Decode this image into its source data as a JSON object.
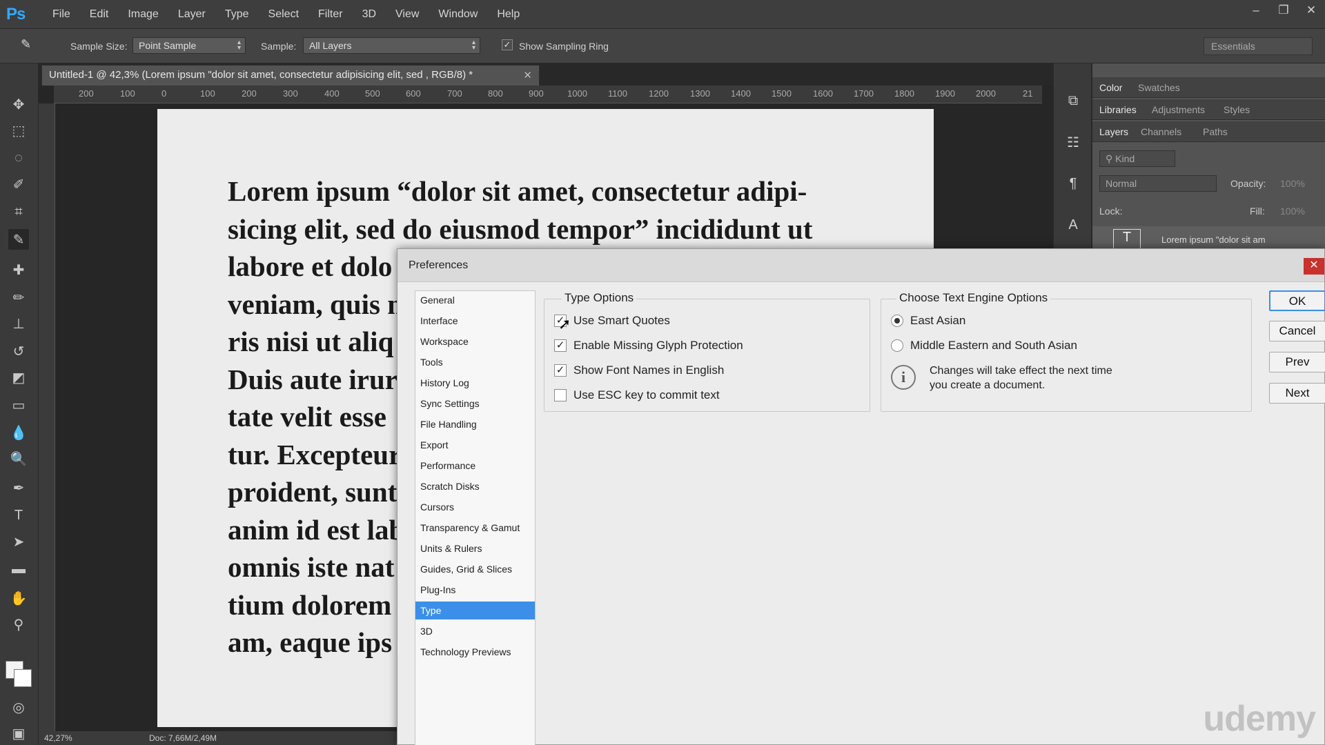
{
  "app": {
    "logo": "Ps",
    "menus": [
      "File",
      "Edit",
      "Image",
      "Layer",
      "Type",
      "Select",
      "Filter",
      "3D",
      "View",
      "Window",
      "Help"
    ],
    "window_controls": [
      "–",
      "❐",
      "✕"
    ]
  },
  "options_bar": {
    "sample_size_label": "Sample Size:",
    "sample_size_value": "Point Sample",
    "sample_label": "Sample:",
    "sample_value": "All Layers",
    "show_sampling_ring_label": "Show Sampling Ring",
    "show_sampling_ring_checked": true,
    "workspace": "Essentials"
  },
  "document": {
    "tab_title": "Untitled-1 @ 42,3% (Lorem ipsum \"dolor sit amet, consectetur adipisicing elit, sed , RGB/8) *",
    "ruler_labels": [
      "200",
      "100",
      "0",
      "100",
      "200",
      "300",
      "400",
      "500",
      "600",
      "700",
      "800",
      "900",
      "1000",
      "1100",
      "1200",
      "1300",
      "1400",
      "1500",
      "1600",
      "1700",
      "1800",
      "1900",
      "2000",
      "21"
    ],
    "text_lines": [
      "Lorem ipsum “dolor sit amet, consectetur adipi-",
      "sicing elit, sed do eiusmod tempor” incididunt ut",
      "labore et dolo",
      "veniam, quis n",
      "ris nisi ut aliq",
      "Duis aute irur",
      "tate velit esse",
      "tur. Excepteur",
      "proident, sunt",
      "anim id est lab",
      "omnis iste nat",
      "tium dolorem",
      "am, eaque ips"
    ],
    "status_zoom": "42,27%",
    "status_doc": "Doc: 7,66M/2,49M"
  },
  "panels": {
    "row1": [
      "Color",
      "Swatches"
    ],
    "row2": [
      "Libraries",
      "Adjustments",
      "Styles"
    ],
    "row3": [
      "Layers",
      "Channels",
      "Paths"
    ],
    "kind_label": "Kind",
    "blend_mode": "Normal",
    "opacity_label": "Opacity:",
    "opacity_value": "100%",
    "lock_label": "Lock:",
    "fill_label": "Fill:",
    "fill_value": "100%",
    "layer_name": "Lorem ipsum \"dolor sit am"
  },
  "preferences": {
    "title": "Preferences",
    "nav_items": [
      "General",
      "Interface",
      "Workspace",
      "Tools",
      "History Log",
      "Sync Settings",
      "File Handling",
      "Export",
      "Performance",
      "Scratch Disks",
      "Cursors",
      "Transparency & Gamut",
      "Units & Rulers",
      "Guides, Grid & Slices",
      "Plug-Ins",
      "Type",
      "3D",
      "Technology Previews"
    ],
    "selected_nav": "Type",
    "type_options": {
      "title": "Type Options",
      "items": [
        {
          "label": "Use Smart Quotes",
          "checked": true
        },
        {
          "label": "Enable Missing Glyph Protection",
          "checked": true
        },
        {
          "label": "Show Font Names in English",
          "checked": true
        },
        {
          "label": "Use ESC key to commit text",
          "checked": false
        }
      ]
    },
    "text_engine": {
      "title": "Choose Text Engine Options",
      "options": [
        {
          "label": "East Asian",
          "selected": true
        },
        {
          "label": "Middle Eastern and South Asian",
          "selected": false
        }
      ],
      "info_line1": "Changes will take effect the next time",
      "info_line2": "you create a document."
    },
    "buttons": {
      "ok": "OK",
      "cancel": "Cancel",
      "prev": "Prev",
      "next": "Next"
    }
  },
  "watermark": "udemy",
  "colors": {
    "accent": "#3b8fe8",
    "ps_blue": "#31a8ff",
    "close_red": "#c8312c"
  }
}
